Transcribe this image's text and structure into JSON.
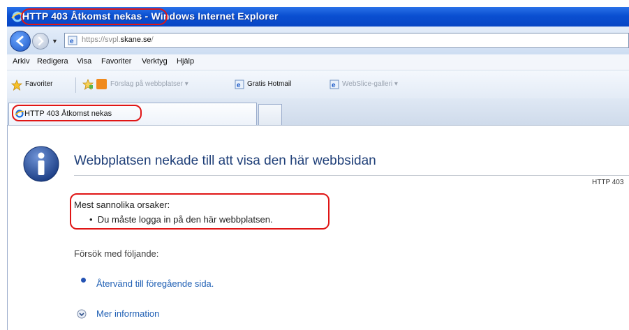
{
  "window": {
    "title_highlighted": "HTTP 403 Åtkomst nekas",
    "title_rest": " - Windows Internet Explorer"
  },
  "address_bar": {
    "url_prefix": "https://svpl.",
    "url_domain": "skane.se",
    "url_suffix": "/"
  },
  "menu": {
    "items": [
      "Arkiv",
      "Redigera",
      "Visa",
      "Favoriter",
      "Verktyg",
      "Hjälp"
    ]
  },
  "favorites_bar": {
    "favorites_label": "Favoriter",
    "suggested_sites": "Förslag på webbplatser ▾",
    "hotmail": "Gratis Hotmail",
    "webslice": "WebSlice-galleri ▾"
  },
  "tabs": {
    "active_label": "HTTP 403 Åtkomst nekas"
  },
  "content": {
    "heading": "Webbplatsen nekade till att visa den här webbsidan",
    "http_code": "HTTP 403",
    "causes_title": "Mest sannolika orsaker:",
    "causes": [
      "Du måste logga in på den här webbplatsen."
    ],
    "try_title": "Försök med följande:",
    "back_link": "Återvänd till föregående sida.",
    "more_info": "Mer information"
  },
  "colors": {
    "highlight": "#e01515",
    "link": "#1f5fb4",
    "heading": "#1f3f78",
    "titlebar": "#0a4fd1"
  }
}
